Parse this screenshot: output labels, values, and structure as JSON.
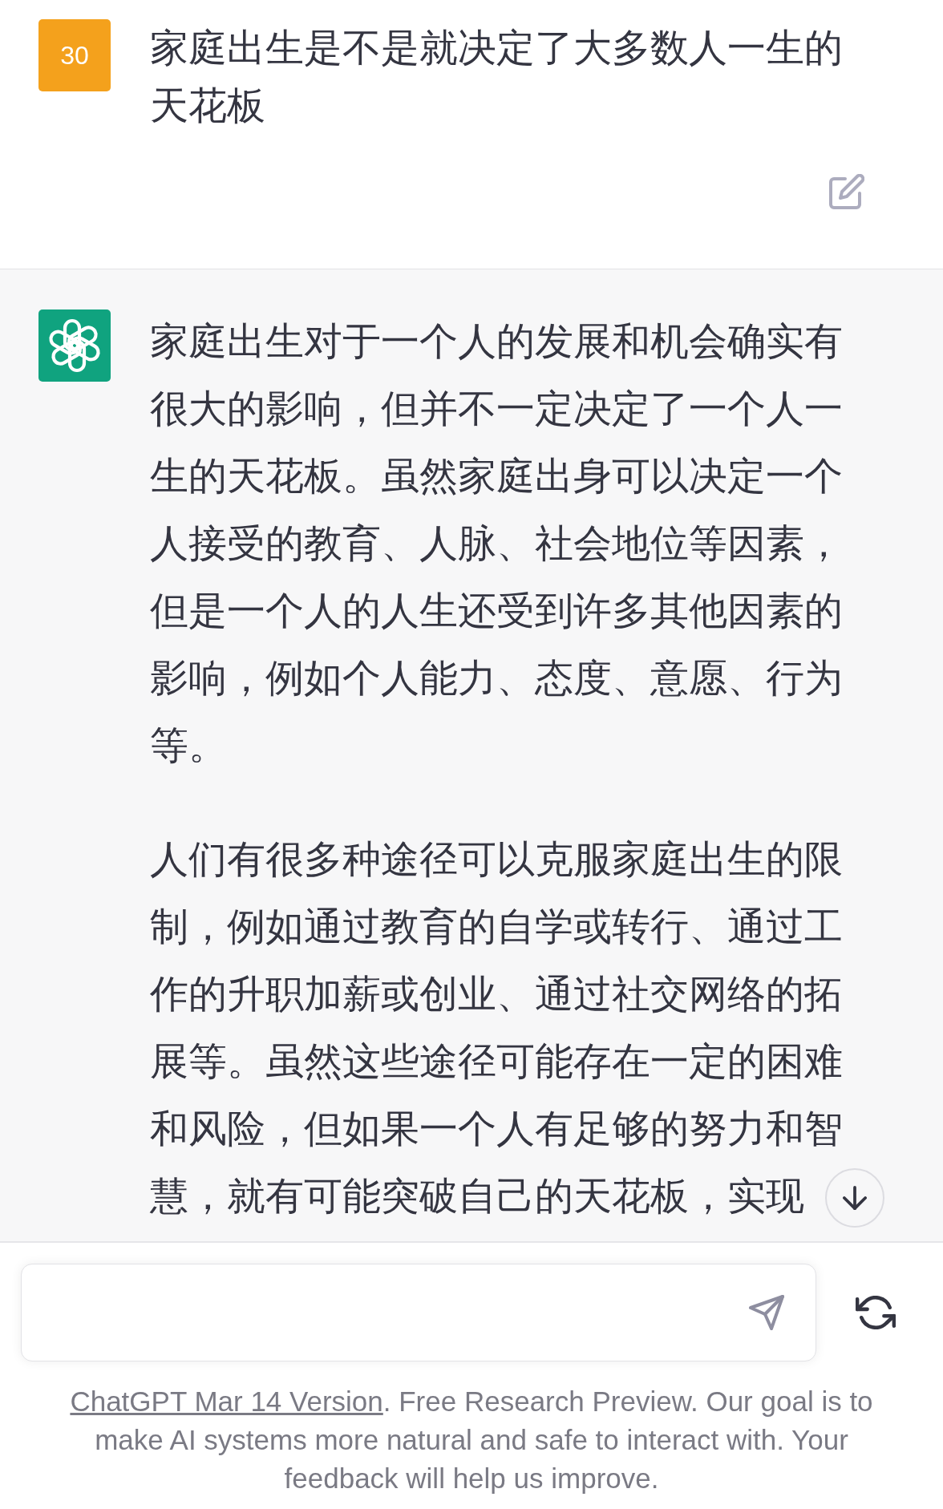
{
  "conversation": [
    {
      "kind": "user",
      "avatar": "30",
      "paragraphs": [
        "家庭出生是不是就决定了大多数人一生的天花板"
      ]
    },
    {
      "kind": "assistant",
      "paragraphs": [
        "家庭出生对于一个人的发展和机会确实有很大的影响，但并不一定决定了一个人一生的天花板。虽然家庭出身可以决定一个人接受的教育、人脉、社会地位等因素，但是一个人的人生还受到许多其他因素的影响，例如个人能力、态度、意愿、行为等。",
        "人们有很多种途径可以克服家庭出生的限制，例如通过教育的自学或转行、通过工作的升职加薪或创业、通过社交网络的拓展等。虽然这些途径可能存在一定的困难和风险，但如果一个人有足够的努力和智慧，就有可能突破自己的天花板，实现"
      ]
    }
  ],
  "footer": {
    "link": "ChatGPT Mar 14 Version",
    "text": ". Free Research Preview. Our goal is to make AI systems more natural and safe to interact with. Your feedback will help us improve."
  }
}
